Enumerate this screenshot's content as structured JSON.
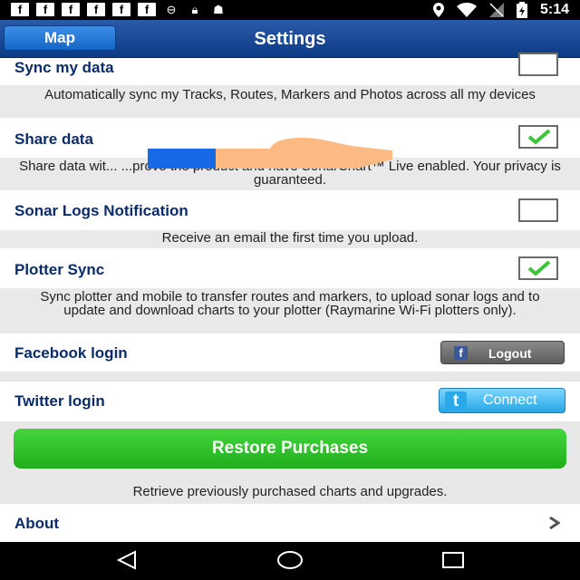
{
  "status_bar": {
    "time": "5:14"
  },
  "title_bar": {
    "back_label": "Map",
    "title": "Settings"
  },
  "settings": [
    {
      "label": "Sync my data",
      "checked": false,
      "description": "Automatically sync my Tracks, Routes, Markers and Photos across all my devices"
    },
    {
      "label": "Share data",
      "checked": true,
      "description": "Share data wit... ...prove the product and have SonarChart™ Live enabled. Your privacy is guaranteed."
    },
    {
      "label": "Sonar Logs Notification",
      "checked": false,
      "description": "Receive an email the first time you upload."
    },
    {
      "label": "Plotter Sync",
      "checked": true,
      "description": "Sync plotter and mobile to transfer routes and markers, to upload sonar logs and to update and download charts to your plotter (Raymarine Wi-Fi plotters only)."
    }
  ],
  "facebook": {
    "label": "Facebook login",
    "button": "Logout"
  },
  "twitter": {
    "label": "Twitter login",
    "button": "Connect"
  },
  "restore": {
    "button": "Restore Purchases",
    "description": "Retrieve previously purchased charts and upgrades."
  },
  "about": {
    "label": "About"
  },
  "colors": {
    "title_bar": "#0d3b86",
    "green": "#28b423",
    "accent_text": "#0b2c6a"
  }
}
